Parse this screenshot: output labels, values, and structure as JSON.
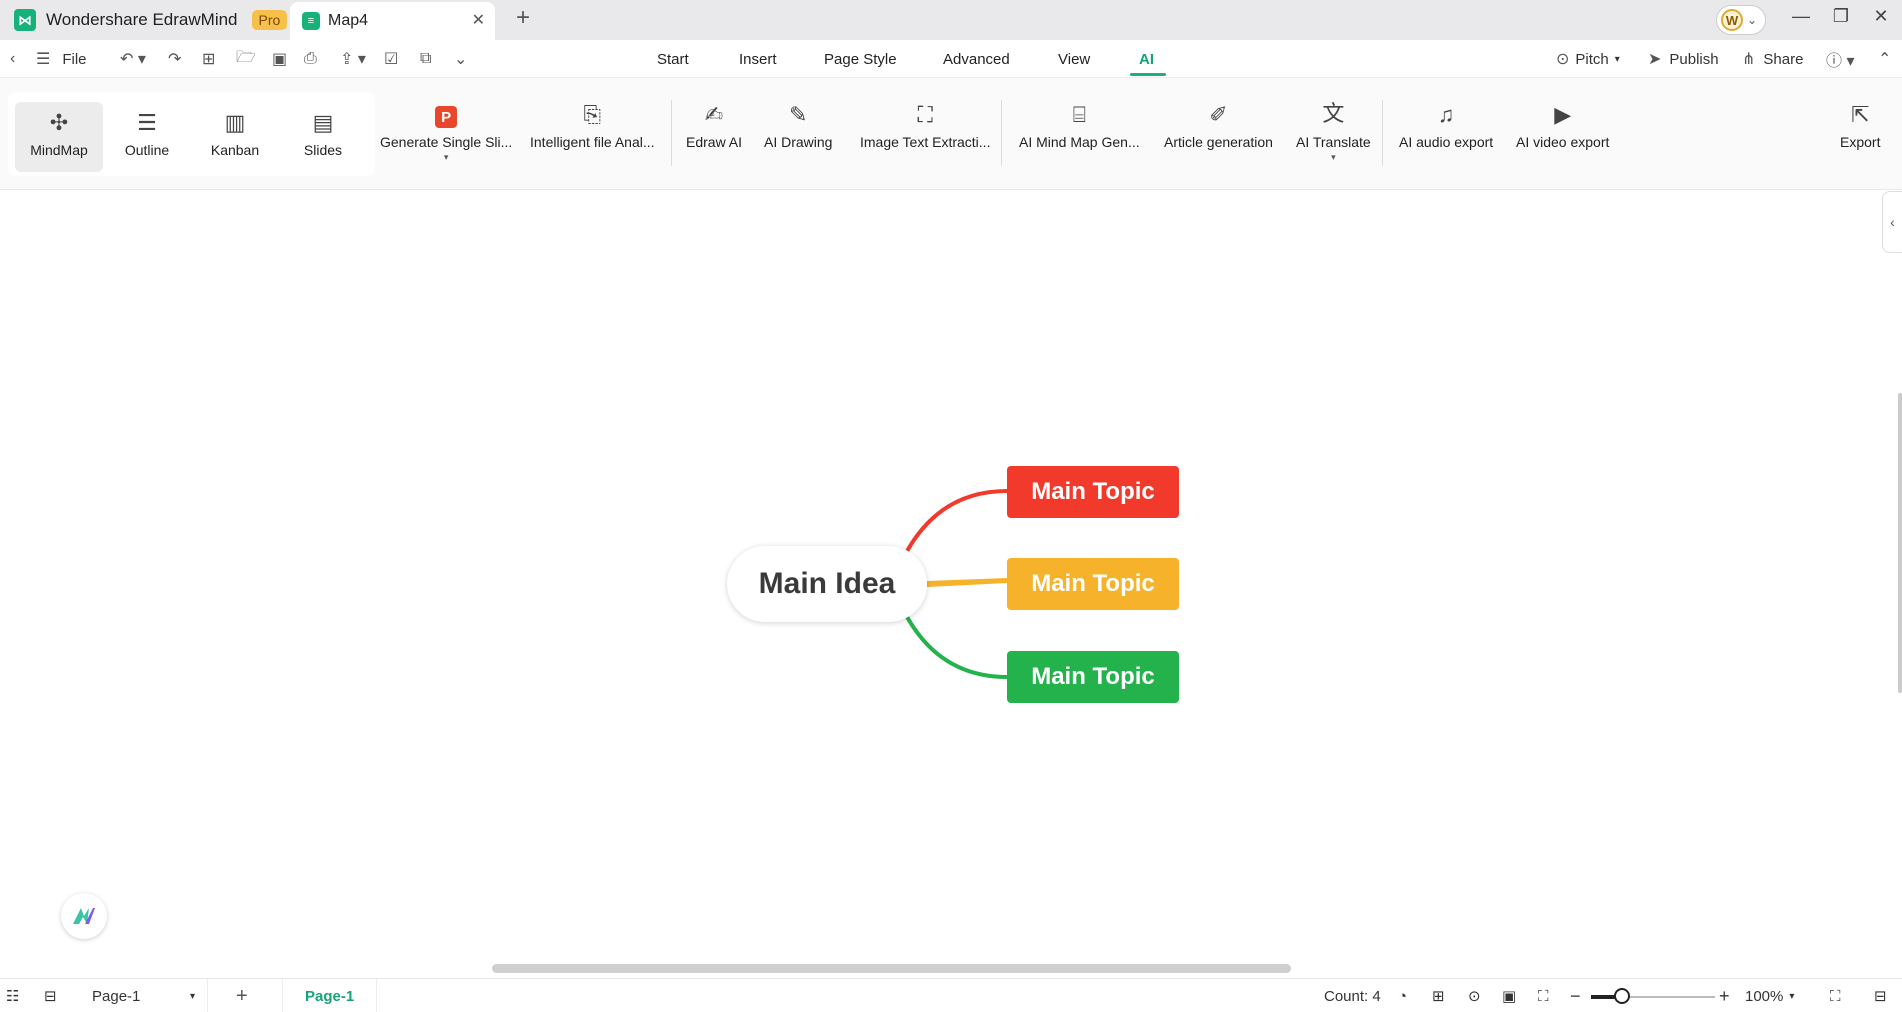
{
  "titlebar": {
    "app_name": "Wondershare EdrawMind",
    "badge": "Pro",
    "doc_tab": "Map4",
    "avatar_letter": "W"
  },
  "menubar": {
    "file": "File",
    "tabs": [
      "Start",
      "Insert",
      "Page Style",
      "Advanced",
      "View",
      "AI"
    ],
    "active_tab": "AI",
    "pitch": "Pitch",
    "publish": "Publish",
    "share": "Share"
  },
  "ribbon": {
    "views": [
      "MindMap",
      "Outline",
      "Kanban",
      "Slides"
    ],
    "tools": [
      "Generate Single Sli...",
      "Intelligent file Anal...",
      "Edraw AI",
      "AI Drawing",
      "Image Text Extracti...",
      "AI Mind Map Gen...",
      "Article generation",
      "AI Translate",
      "AI audio export",
      "AI video export",
      "Export"
    ]
  },
  "canvas": {
    "main_idea": "Main Idea",
    "topics": [
      {
        "label": "Main Topic",
        "color": "#f23a2c"
      },
      {
        "label": "Main Topic",
        "color": "#f6b22a"
      },
      {
        "label": "Main Topic",
        "color": "#23b24b"
      }
    ]
  },
  "statusbar": {
    "page_select": "Page-1",
    "page_tab": "Page-1",
    "count": "Count: 4",
    "zoom": "100%"
  },
  "colors": {
    "accent": "#17b27a",
    "topic_red": "#f23a2c",
    "topic_yellow": "#f6b22a",
    "topic_green": "#23b24b"
  }
}
